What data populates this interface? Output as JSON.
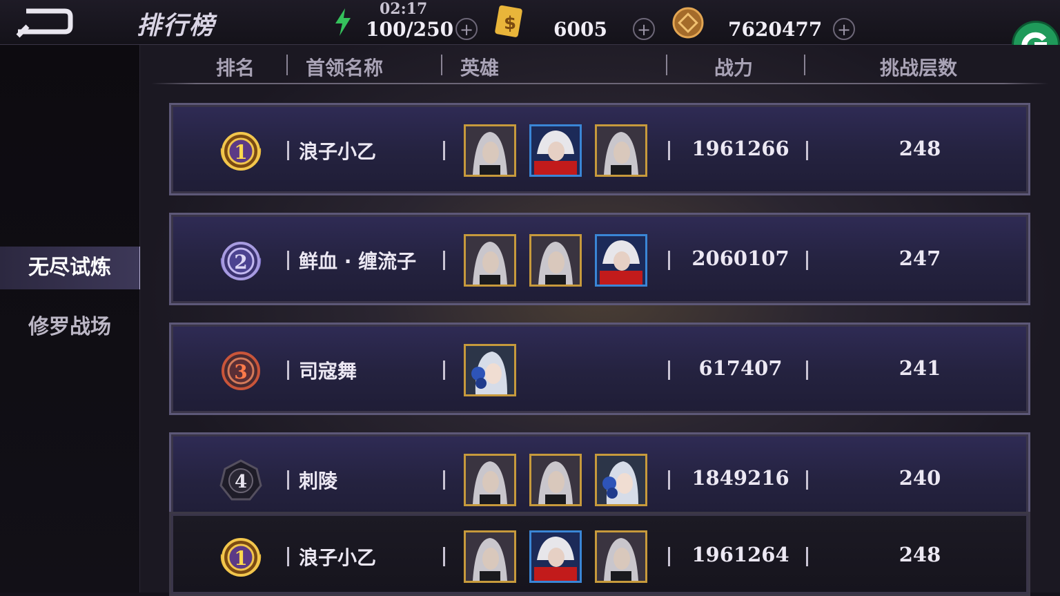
{
  "header": {
    "title": "排行榜",
    "time": "02:17",
    "stamina": "100/250",
    "gold_ticket": "6005",
    "coins": "7620477"
  },
  "sidebar": {
    "items": [
      {
        "label": "无尽试炼",
        "active": true
      },
      {
        "label": "修罗战场",
        "active": false
      }
    ]
  },
  "table": {
    "columns": [
      "排名",
      "首领名称",
      "英雄",
      "战力",
      "挑战层数"
    ],
    "rows": [
      {
        "rank": "1",
        "name": "浪子小乙",
        "power": "1961266",
        "floor": "248",
        "heroes": [
          "silver-hair-dark",
          "red-scarf",
          "silver-hair-dark"
        ]
      },
      {
        "rank": "2",
        "name": "鲜血 · 缠流子",
        "power": "2060107",
        "floor": "247",
        "heroes": [
          "silver-hair-dark",
          "silver-hair-dark",
          "red-scarf"
        ]
      },
      {
        "rank": "3",
        "name": "司寇舞",
        "power": "617407",
        "floor": "241",
        "heroes": [
          "blue-flower"
        ]
      },
      {
        "rank": "4",
        "name": "刺陵",
        "power": "1849216",
        "floor": "240",
        "heroes": [
          "silver-hair-dark",
          "silver-hair-dark",
          "blue-flower"
        ]
      },
      {
        "rank": "1",
        "name": "浪子小乙",
        "power": "1961264",
        "floor": "248",
        "heroes": [
          "silver-hair-dark",
          "red-scarf",
          "silver-hair-dark"
        ]
      }
    ]
  },
  "colors": {
    "gold_medal": "#e8b73a",
    "silver_medal": "#7b6fc4",
    "bronze_medal": "#c9553a",
    "row_bg": "#2b284c",
    "hero_frame_gold": "#c79a3c",
    "hero_frame_blue": "#3a86d6"
  }
}
